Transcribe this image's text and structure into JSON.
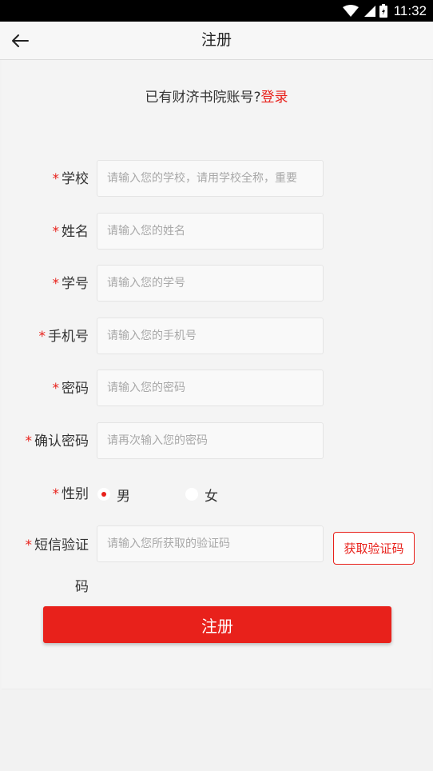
{
  "status_bar": {
    "time": "11:32",
    "icons": [
      "wifi-icon",
      "signal-icon",
      "battery-icon"
    ]
  },
  "header": {
    "title": "注册"
  },
  "login_prompt": {
    "text": "已有财济书院账号?",
    "link": "登录"
  },
  "form": {
    "required_mark": "*",
    "school": {
      "label": "学校",
      "placeholder": "请输入您的学校，请用学校全称，重要"
    },
    "name": {
      "label": "姓名",
      "placeholder": "请输入您的姓名"
    },
    "student_id": {
      "label": "学号",
      "placeholder": "请输入您的学号"
    },
    "phone": {
      "label": "手机号",
      "placeholder": "请输入您的手机号"
    },
    "password": {
      "label": "密码",
      "placeholder": "请输入您的密码"
    },
    "confirm_password": {
      "label": "确认密码",
      "placeholder": "请再次输入您的密码"
    },
    "gender": {
      "label": "性别",
      "options": [
        "男",
        "女"
      ],
      "selected": "男"
    },
    "sms_code": {
      "label_line1": "短信验证",
      "label_line2": "码",
      "placeholder": "请输入您所获取的验证码",
      "button": "获取验证码"
    },
    "submit": "注册"
  },
  "colors": {
    "accent": "#e8211b",
    "background": "#f2f2f2",
    "status_bar": "#000000"
  }
}
